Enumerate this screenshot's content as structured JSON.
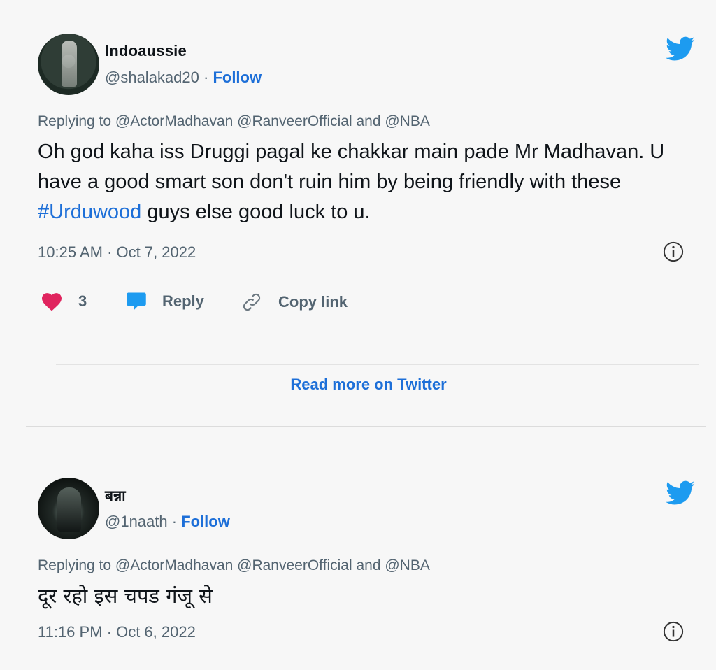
{
  "tweets": [
    {
      "display_name": "Indoaussie",
      "handle": "@shalakad20",
      "separator": " · ",
      "follow_label": "Follow",
      "replying_to": "Replying to @ActorMadhavan @RanveerOfficial and @NBA",
      "text_before_hashtag": "Oh god kaha iss Druggi pagal ke chakkar main pade Mr Madhavan. U have a good smart son don't ruin him by being friendly with these ",
      "hashtag": "#Urduwood",
      "text_after_hashtag": " guys else good luck to u.",
      "timestamp": "10:25 AM · Oct 7, 2022",
      "like_count": "3",
      "reply_label": "Reply",
      "copy_link_label": "Copy link",
      "read_more_label": "Read more on Twitter"
    },
    {
      "display_name": "बन्ना",
      "handle": "@1naath",
      "separator": " · ",
      "follow_label": "Follow",
      "replying_to": "Replying to @ActorMadhavan @RanveerOfficial and @NBA",
      "text": "दूर रहो इस चपड गंजू से",
      "timestamp": "11:16 PM · Oct 6, 2022"
    }
  ],
  "icons": {
    "bird": "twitter-bird-icon",
    "info": "info-icon",
    "like": "heart-icon",
    "reply": "speech-bubble-icon",
    "copy": "link-icon"
  },
  "colors": {
    "link_blue": "#1d6fd8",
    "twitter_blue": "#1d9bf0",
    "like_red": "#e0245e",
    "muted_gray": "#536471"
  }
}
